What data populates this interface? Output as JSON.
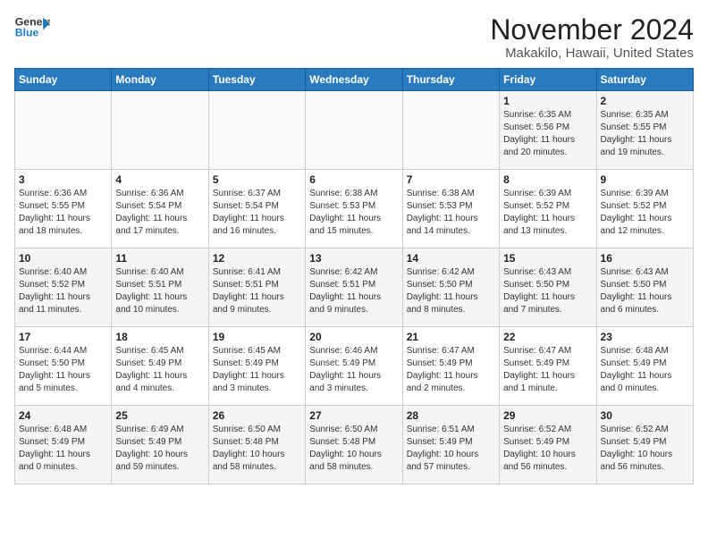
{
  "header": {
    "logo_general": "General",
    "logo_blue": "Blue",
    "month": "November 2024",
    "location": "Makakilo, Hawaii, United States"
  },
  "weekdays": [
    "Sunday",
    "Monday",
    "Tuesday",
    "Wednesday",
    "Thursday",
    "Friday",
    "Saturday"
  ],
  "weeks": [
    [
      {
        "day": "",
        "detail": ""
      },
      {
        "day": "",
        "detail": ""
      },
      {
        "day": "",
        "detail": ""
      },
      {
        "day": "",
        "detail": ""
      },
      {
        "day": "",
        "detail": ""
      },
      {
        "day": "1",
        "detail": "Sunrise: 6:35 AM\nSunset: 5:56 PM\nDaylight: 11 hours\nand 20 minutes."
      },
      {
        "day": "2",
        "detail": "Sunrise: 6:35 AM\nSunset: 5:55 PM\nDaylight: 11 hours\nand 19 minutes."
      }
    ],
    [
      {
        "day": "3",
        "detail": "Sunrise: 6:36 AM\nSunset: 5:55 PM\nDaylight: 11 hours\nand 18 minutes."
      },
      {
        "day": "4",
        "detail": "Sunrise: 6:36 AM\nSunset: 5:54 PM\nDaylight: 11 hours\nand 17 minutes."
      },
      {
        "day": "5",
        "detail": "Sunrise: 6:37 AM\nSunset: 5:54 PM\nDaylight: 11 hours\nand 16 minutes."
      },
      {
        "day": "6",
        "detail": "Sunrise: 6:38 AM\nSunset: 5:53 PM\nDaylight: 11 hours\nand 15 minutes."
      },
      {
        "day": "7",
        "detail": "Sunrise: 6:38 AM\nSunset: 5:53 PM\nDaylight: 11 hours\nand 14 minutes."
      },
      {
        "day": "8",
        "detail": "Sunrise: 6:39 AM\nSunset: 5:52 PM\nDaylight: 11 hours\nand 13 minutes."
      },
      {
        "day": "9",
        "detail": "Sunrise: 6:39 AM\nSunset: 5:52 PM\nDaylight: 11 hours\nand 12 minutes."
      }
    ],
    [
      {
        "day": "10",
        "detail": "Sunrise: 6:40 AM\nSunset: 5:52 PM\nDaylight: 11 hours\nand 11 minutes."
      },
      {
        "day": "11",
        "detail": "Sunrise: 6:40 AM\nSunset: 5:51 PM\nDaylight: 11 hours\nand 10 minutes."
      },
      {
        "day": "12",
        "detail": "Sunrise: 6:41 AM\nSunset: 5:51 PM\nDaylight: 11 hours\nand 9 minutes."
      },
      {
        "day": "13",
        "detail": "Sunrise: 6:42 AM\nSunset: 5:51 PM\nDaylight: 11 hours\nand 9 minutes."
      },
      {
        "day": "14",
        "detail": "Sunrise: 6:42 AM\nSunset: 5:50 PM\nDaylight: 11 hours\nand 8 minutes."
      },
      {
        "day": "15",
        "detail": "Sunrise: 6:43 AM\nSunset: 5:50 PM\nDaylight: 11 hours\nand 7 minutes."
      },
      {
        "day": "16",
        "detail": "Sunrise: 6:43 AM\nSunset: 5:50 PM\nDaylight: 11 hours\nand 6 minutes."
      }
    ],
    [
      {
        "day": "17",
        "detail": "Sunrise: 6:44 AM\nSunset: 5:50 PM\nDaylight: 11 hours\nand 5 minutes."
      },
      {
        "day": "18",
        "detail": "Sunrise: 6:45 AM\nSunset: 5:49 PM\nDaylight: 11 hours\nand 4 minutes."
      },
      {
        "day": "19",
        "detail": "Sunrise: 6:45 AM\nSunset: 5:49 PM\nDaylight: 11 hours\nand 3 minutes."
      },
      {
        "day": "20",
        "detail": "Sunrise: 6:46 AM\nSunset: 5:49 PM\nDaylight: 11 hours\nand 3 minutes."
      },
      {
        "day": "21",
        "detail": "Sunrise: 6:47 AM\nSunset: 5:49 PM\nDaylight: 11 hours\nand 2 minutes."
      },
      {
        "day": "22",
        "detail": "Sunrise: 6:47 AM\nSunset: 5:49 PM\nDaylight: 11 hours\nand 1 minute."
      },
      {
        "day": "23",
        "detail": "Sunrise: 6:48 AM\nSunset: 5:49 PM\nDaylight: 11 hours\nand 0 minutes."
      }
    ],
    [
      {
        "day": "24",
        "detail": "Sunrise: 6:48 AM\nSunset: 5:49 PM\nDaylight: 11 hours\nand 0 minutes."
      },
      {
        "day": "25",
        "detail": "Sunrise: 6:49 AM\nSunset: 5:49 PM\nDaylight: 10 hours\nand 59 minutes."
      },
      {
        "day": "26",
        "detail": "Sunrise: 6:50 AM\nSunset: 5:48 PM\nDaylight: 10 hours\nand 58 minutes."
      },
      {
        "day": "27",
        "detail": "Sunrise: 6:50 AM\nSunset: 5:48 PM\nDaylight: 10 hours\nand 58 minutes."
      },
      {
        "day": "28",
        "detail": "Sunrise: 6:51 AM\nSunset: 5:49 PM\nDaylight: 10 hours\nand 57 minutes."
      },
      {
        "day": "29",
        "detail": "Sunrise: 6:52 AM\nSunset: 5:49 PM\nDaylight: 10 hours\nand 56 minutes."
      },
      {
        "day": "30",
        "detail": "Sunrise: 6:52 AM\nSunset: 5:49 PM\nDaylight: 10 hours\nand 56 minutes."
      }
    ]
  ]
}
